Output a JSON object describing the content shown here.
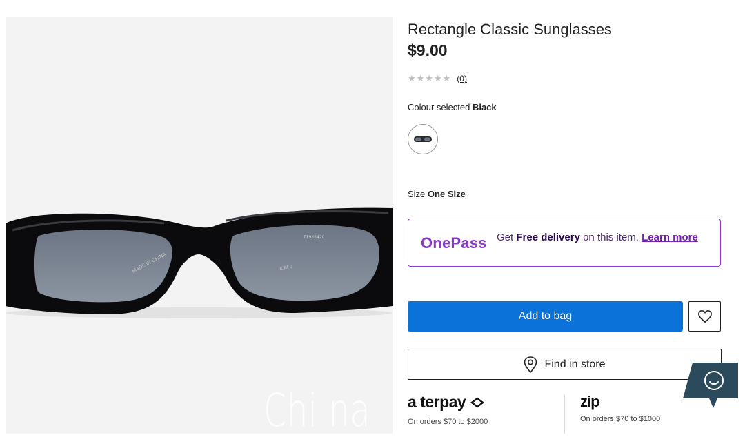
{
  "product": {
    "title": "Rectangle Classic Sunglasses",
    "price": "$9.00",
    "rating_stars": "★★★★★",
    "review_count": "(0)",
    "image_alt": "Rectangle Classic Sunglasses in black",
    "arm_text_left": "MADE IN CHINA",
    "arm_text_right": "ICAT 2",
    "lens_code": "T1935420"
  },
  "colour": {
    "label": "Colour selected",
    "selected": "Black",
    "swatch_icon": "sunglasses-swatch-icon"
  },
  "size": {
    "label": "Size",
    "selected": "One Size"
  },
  "onepass": {
    "logo": "OnePass",
    "text_prefix": "Get",
    "text_bold": "Free delivery",
    "text_suffix": "on this item.",
    "link": "Learn more",
    "brand_color": "#8a3bc9"
  },
  "actions": {
    "add_to_bag": "Add to bag",
    "find_in_store": "Find in store",
    "wishlist_icon": "heart-icon",
    "store_icon": "location-pin-icon",
    "accent_color": "#0a72d9"
  },
  "payments": {
    "afterpay_logo": "a terpay",
    "afterpay_note": "On orders $70 to $2000",
    "zip_logo": "zip",
    "zip_note": "On orders $70 to $1000"
  },
  "watermark": "Chi na",
  "chat": {
    "icon": "chat-smile-icon"
  }
}
